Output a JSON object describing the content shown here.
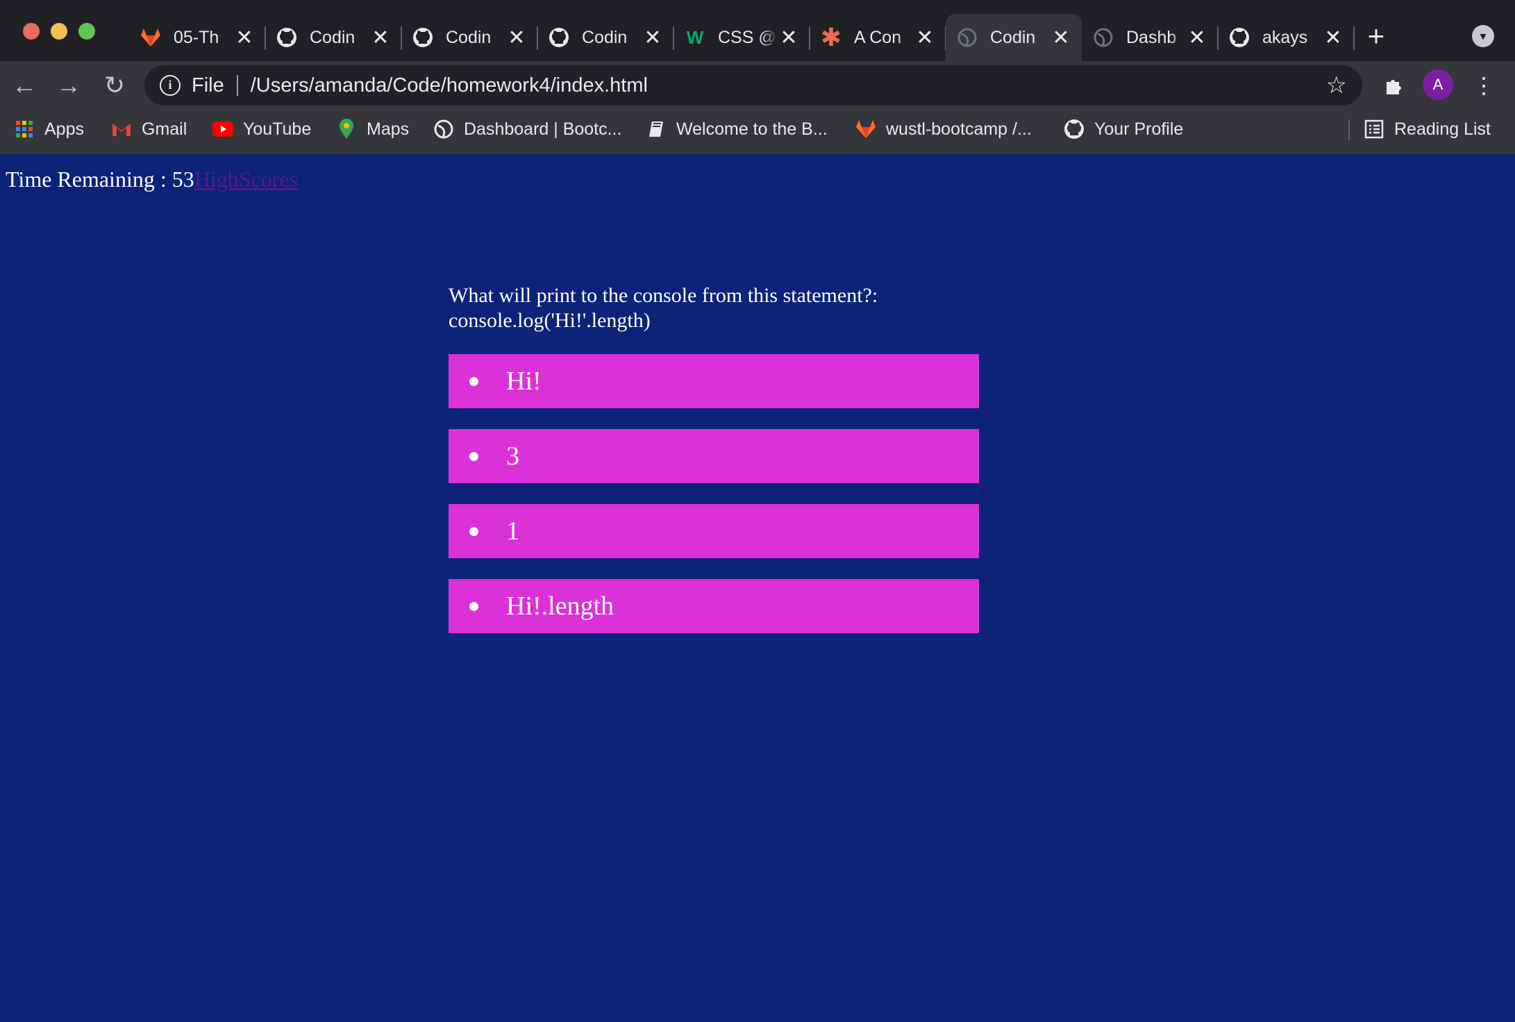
{
  "browser": {
    "tabs": [
      {
        "title": "05-Th",
        "icon": "gitlab-icon",
        "active": false
      },
      {
        "title": "Codin",
        "icon": "github-icon",
        "active": false
      },
      {
        "title": "Codin",
        "icon": "github-icon",
        "active": false
      },
      {
        "title": "Codin",
        "icon": "github-icon",
        "active": false
      },
      {
        "title": "CSS @",
        "icon": "w3schools-icon",
        "active": false
      },
      {
        "title": "A Con",
        "icon": "asterisk-icon",
        "active": false
      },
      {
        "title": "Codin",
        "icon": "globe-icon",
        "active": true
      },
      {
        "title": "Dashb",
        "icon": "globe-icon",
        "active": false
      },
      {
        "title": "akays",
        "icon": "github-icon",
        "active": false
      }
    ],
    "omnibox": {
      "scheme": "File",
      "url": "/Users/amanda/Code/homework4/index.html"
    },
    "profile_initial": "A",
    "bookmarks": [
      {
        "label": "Apps",
        "icon": "apps-grid-icon"
      },
      {
        "label": "Gmail",
        "icon": "gmail-icon"
      },
      {
        "label": "YouTube",
        "icon": "youtube-icon"
      },
      {
        "label": "Maps",
        "icon": "maps-pin-icon"
      },
      {
        "label": "Dashboard | Bootc...",
        "icon": "globe-icon"
      },
      {
        "label": "Welcome to the B...",
        "icon": "book-icon"
      },
      {
        "label": "wustl-bootcamp /...",
        "icon": "gitlab-icon"
      },
      {
        "label": "Your Profile",
        "icon": "github-icon"
      }
    ],
    "reading_list": "Reading List"
  },
  "page": {
    "timer_label": "Time Remaining : 53",
    "highscores_link": "HighScores",
    "question": "What will print to the console from this statement?: console.log('Hi!'.length)",
    "choices": [
      "Hi!",
      "3",
      "1",
      "Hi!.length"
    ],
    "colors": {
      "background": "#0c2379",
      "choice_bg": "#da31d9",
      "text": "#ffffff",
      "link": "#551a8b"
    }
  }
}
